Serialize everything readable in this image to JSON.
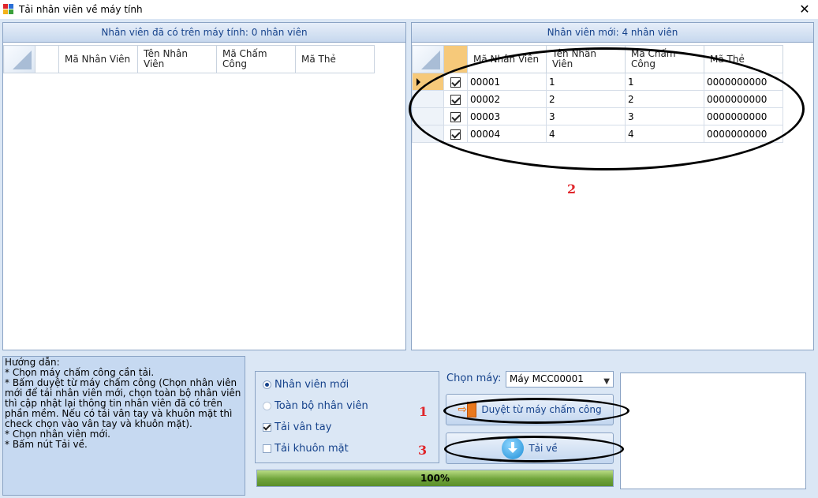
{
  "window": {
    "title": "Tải nhân viên về máy tính",
    "close_glyph": "✕"
  },
  "left_panel": {
    "header": "Nhân viên đã có trên máy tính: 0 nhân viên",
    "columns": [
      "Mã Nhân Viên",
      "Tên Nhân Viên",
      "Mã Chấm Công",
      "Mã Thẻ"
    ]
  },
  "right_panel": {
    "header": "Nhân viên mới: 4 nhân viên",
    "columns": [
      "Mã Nhân Viên",
      "Tên Nhân Viên",
      "Mã Chấm Công",
      "Mã Thẻ"
    ],
    "rows": [
      {
        "checked": true,
        "ma_nhan_vien": "00001",
        "ten_nhan_vien": "1",
        "ma_cham_cong": "1",
        "ma_the": "0000000000"
      },
      {
        "checked": true,
        "ma_nhan_vien": "00002",
        "ten_nhan_vien": "2",
        "ma_cham_cong": "2",
        "ma_the": "0000000000"
      },
      {
        "checked": true,
        "ma_nhan_vien": "00003",
        "ten_nhan_vien": "3",
        "ma_cham_cong": "3",
        "ma_the": "0000000000"
      },
      {
        "checked": true,
        "ma_nhan_vien": "00004",
        "ten_nhan_vien": "4",
        "ma_cham_cong": "4",
        "ma_the": "0000000000"
      }
    ]
  },
  "guide": {
    "lines": [
      "Hướng dẫn:",
      "* Chọn máy chấm công cần tải.",
      "* Bấm duyệt từ máy chấm công (Chọn nhân viên mới để tải nhân viên mới, chọn toàn bộ nhân viên thì cập nhật lại thông tin nhân viên đã có trên phần mềm. Nếu có tải vân tay và khuôn mặt thì check chọn vào vân tay và khuôn mặt).",
      "* Chọn nhân viên mới.",
      "* Bấm nút Tải về."
    ]
  },
  "options": {
    "radio_new": "Nhân viên mới",
    "radio_all": "Toàn bộ nhân viên",
    "check_fingerprint": "Tải vân tay",
    "check_face": "Tải khuôn mặt",
    "selected_radio": "Nhân viên mới",
    "fingerprint_checked": true,
    "face_checked": false
  },
  "machine": {
    "label": "Chọn máy:",
    "selected": "Máy MCC00001"
  },
  "buttons": {
    "browse": "Duyệt từ máy chấm công",
    "download": "Tải về"
  },
  "progress": {
    "value": 1.0,
    "label": "100%"
  },
  "annotations": {
    "step1": "1",
    "step2": "2",
    "step3": "3"
  },
  "colors": {
    "header_text": "#15428b",
    "annotation": "#e0262b",
    "progress_fill": "#6fa33a"
  }
}
